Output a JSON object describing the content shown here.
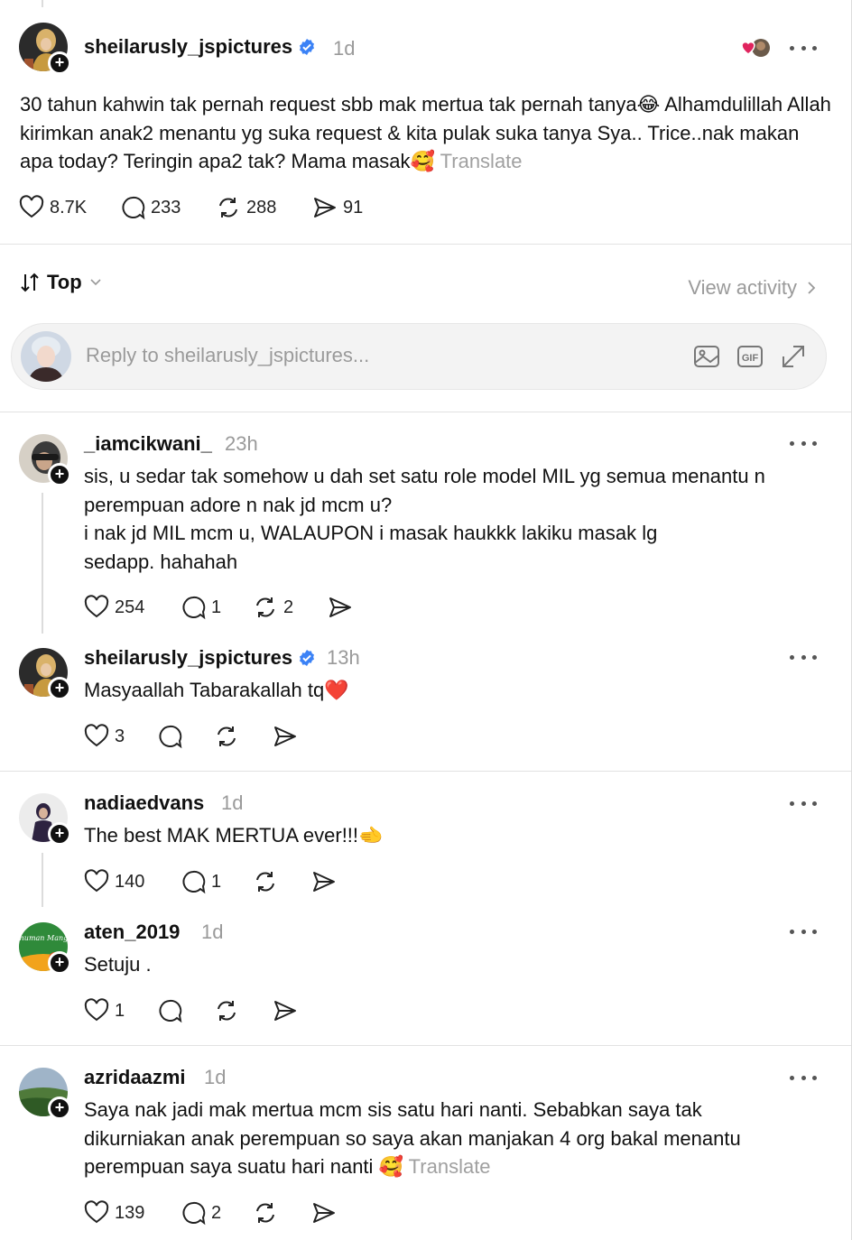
{
  "post": {
    "username": "sheilarusly_jspictures",
    "time": "1d",
    "text": "30 tahun kahwin tak pernah request sbb mak mertua tak pernah tanya😂 Alhamdulillah Allah kirimkan anak2 menantu yg suka request & kita pulak suka tanya Sya.. Trice..nak makan apa today? Teringin apa2 tak? Mama masak🥰",
    "translate": "Translate",
    "likes": "8.7K",
    "replies": "233",
    "reposts": "288",
    "shares": "91"
  },
  "sort": {
    "label": "Top"
  },
  "view_activity": "View activity",
  "reply_input": {
    "placeholder": "Reply to sheilarusly_jspictures..."
  },
  "comments": [
    {
      "username": "_iamcikwani_",
      "time": "23h",
      "text_lines": [
        "sis, u sedar tak somehow u dah set satu role model MIL yg semua menantu n",
        "perempuan adore n nak jd mcm u?",
        "i nak jd MIL mcm u, WALAUPON i masak haukkk lakiku masak lg",
        "sedapp. hahahah"
      ],
      "likes": "254",
      "replies": "1",
      "reposts": "2"
    },
    {
      "username": "sheilarusly_jspictures",
      "time": "13h",
      "text": "Masyaallah Tabarakallah tq❤️",
      "likes": "3"
    },
    {
      "username": "nadiaedvans",
      "time": "1d",
      "text": "The best MAK MERTUA ever!!!🫲",
      "likes": "140",
      "replies": "1"
    },
    {
      "username": "aten_2019",
      "time": "1d",
      "text": "Setuju .",
      "likes": "1",
      "avatar_text": "Minuman Mangga"
    },
    {
      "username": "azridaazmi",
      "time": "1d",
      "text_lines": [
        "Saya nak jadi mak mertua mcm sis satu hari nanti. Sebabkan saya tak",
        "dikurniakan anak perempuan so saya akan manjakan 4 org bakal menantu",
        "perempuan saya suatu hari nanti 🥰"
      ],
      "translate": "Translate",
      "likes": "139",
      "replies": "2"
    }
  ],
  "colors": {
    "verified": "#3b82f6",
    "muted": "#9a9a9a",
    "divider": "#e2e2e2"
  }
}
